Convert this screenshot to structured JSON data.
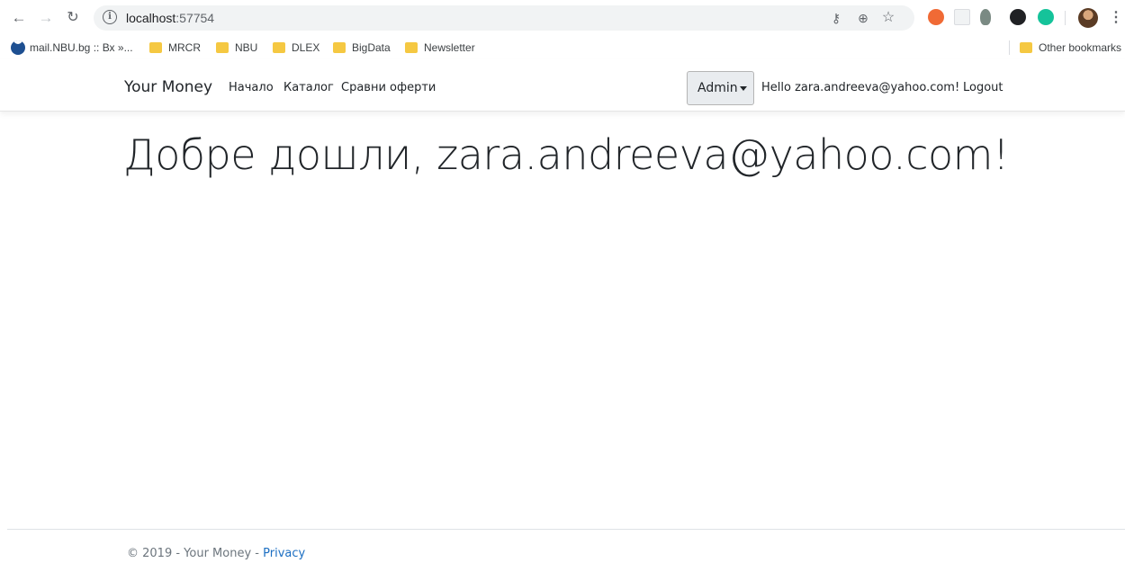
{
  "browser": {
    "url_host": "localhost",
    "url_port": ":57754",
    "bookmarks": [
      {
        "label": "mail.NBU.bg :: Вх »..."
      },
      {
        "label": "MRCR"
      },
      {
        "label": "NBU"
      },
      {
        "label": "DLEX"
      },
      {
        "label": "BigData"
      },
      {
        "label": "Newsletter"
      }
    ],
    "other_bookmarks": "Other bookmarks"
  },
  "navbar": {
    "brand": "Your Money",
    "links": [
      {
        "label": "Начало"
      },
      {
        "label": "Каталог"
      },
      {
        "label": "Сравни оферти"
      }
    ],
    "admin_label": "Admin",
    "greeting": "Hello zara.andreeva@yahoo.com!",
    "logout_label": "Logout"
  },
  "main": {
    "welcome": "Добре дошли, zara.andreeva@yahoo.com!"
  },
  "footer": {
    "copyright": "© 2019 - Your Money - ",
    "privacy_label": "Privacy"
  },
  "colors": {
    "link": "#1b6ec2",
    "folder": "#f5c842",
    "admin_bg": "#e9ecef"
  }
}
